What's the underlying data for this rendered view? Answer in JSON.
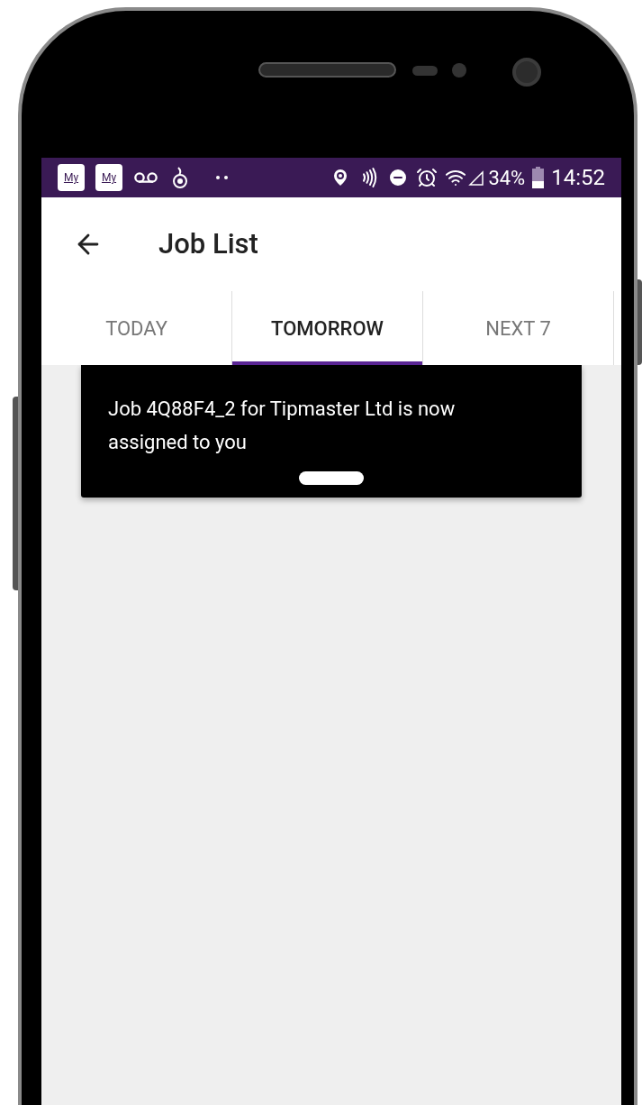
{
  "status_bar": {
    "left_badges": [
      "My",
      "My"
    ],
    "battery": "34%",
    "time": "14:52"
  },
  "app_bar": {
    "title": "Job List"
  },
  "tabs": [
    {
      "label": "TODAY",
      "selected": false
    },
    {
      "label": "TOMORROW",
      "selected": true
    },
    {
      "label": "NEXT 7",
      "selected": false
    }
  ],
  "snackbar": {
    "message": "Job 4Q88F4_2 for Tipmaster Ltd is now assigned to you"
  }
}
